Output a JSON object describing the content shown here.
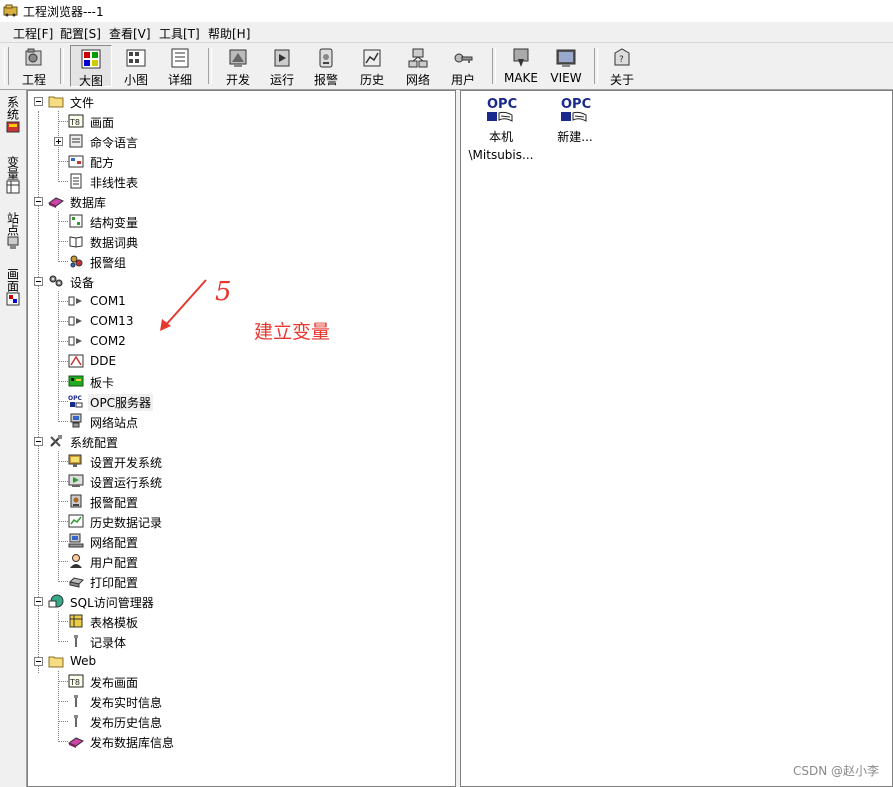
{
  "window": {
    "title": "工程浏览器---1"
  },
  "menu": [
    "工程[F]",
    "配置[S]",
    "查看[V]",
    "工具[T]",
    "帮助[H]"
  ],
  "toolbar": {
    "buttons": [
      "工程",
      "大图",
      "小图",
      "详细",
      "开发",
      "运行",
      "报警",
      "历史",
      "网络",
      "用户",
      "MAKE",
      "VIEW",
      "关于"
    ],
    "pressed": "大图"
  },
  "side_tabs": [
    "系统",
    "变量",
    "站点",
    "画面"
  ],
  "tree": {
    "file": {
      "label": "文件",
      "children": [
        "画面",
        "命令语言",
        "配方",
        "非线性表"
      ]
    },
    "database": {
      "label": "数据库",
      "children": [
        "结构变量",
        "数据词典",
        "报警组"
      ]
    },
    "device": {
      "label": "设备",
      "children": [
        "COM1",
        "COM13",
        "COM2",
        "DDE",
        "板卡",
        "OPC服务器",
        "网络站点"
      ],
      "selected": "OPC服务器"
    },
    "sysconfig": {
      "label": "系统配置",
      "children": [
        "设置开发系统",
        "设置运行系统",
        "报警配置",
        "历史数据记录",
        "网络配置",
        "用户配置",
        "打印配置"
      ]
    },
    "sql": {
      "label": "SQL访问管理器",
      "children": [
        "表格模板",
        "记录体"
      ]
    },
    "web": {
      "label": "Web",
      "children": [
        "发布画面",
        "发布实时信息",
        "发布历史信息",
        "发布数据库信息"
      ]
    }
  },
  "list_items": [
    {
      "icon_text": "OPC",
      "label_line1": "本机",
      "label_line2": "\\Mitsubis..."
    },
    {
      "icon_text": "OPC",
      "label_line1": "新建...",
      "label_line2": ""
    }
  ],
  "annotation": {
    "number": "5",
    "text": "建立变量",
    "color": "#e6382f"
  },
  "watermark": "CSDN @赵小李"
}
